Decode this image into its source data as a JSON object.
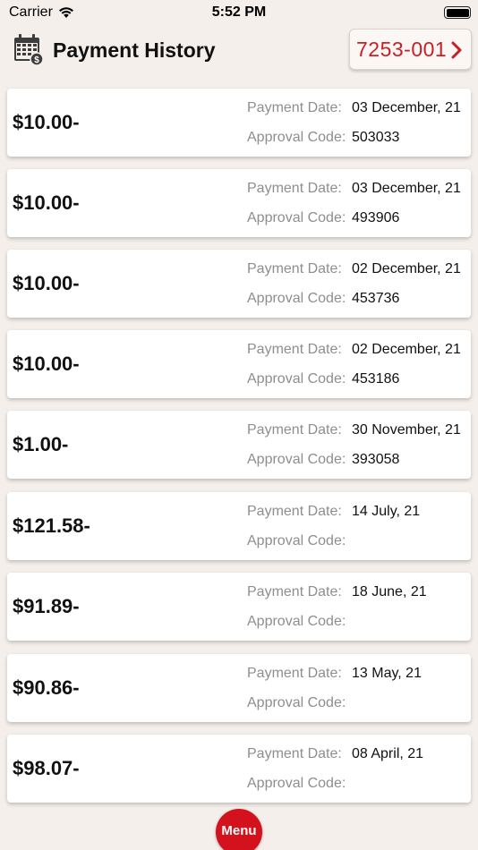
{
  "status_bar": {
    "carrier": "Carrier",
    "time": "5:52 PM"
  },
  "header": {
    "title": "Payment History",
    "account_number": "7253-001",
    "icon": "calendar-dollar-icon"
  },
  "labels": {
    "payment_date": "Payment Date:",
    "approval_code": "Approval Code:"
  },
  "payments": [
    {
      "amount": "$10.00-",
      "date": "03 December, 21",
      "code": "503033"
    },
    {
      "amount": "$10.00-",
      "date": "03 December, 21",
      "code": "493906"
    },
    {
      "amount": "$10.00-",
      "date": "02 December, 21",
      "code": "453736"
    },
    {
      "amount": "$10.00-",
      "date": "02 December, 21",
      "code": "453186"
    },
    {
      "amount": "$1.00-",
      "date": "30 November, 21",
      "code": "393058"
    },
    {
      "amount": "$121.58-",
      "date": "14 July, 21",
      "code": ""
    },
    {
      "amount": "$91.89-",
      "date": "18 June, 21",
      "code": ""
    },
    {
      "amount": "$90.86-",
      "date": "13 May, 21",
      "code": ""
    },
    {
      "amount": "$98.07-",
      "date": "08 April, 21",
      "code": ""
    }
  ],
  "menu": {
    "label": "Menu"
  },
  "colors": {
    "accent": "#c81e24",
    "menu_bg": "#d4121e",
    "page_bg": "#f4efeb"
  }
}
